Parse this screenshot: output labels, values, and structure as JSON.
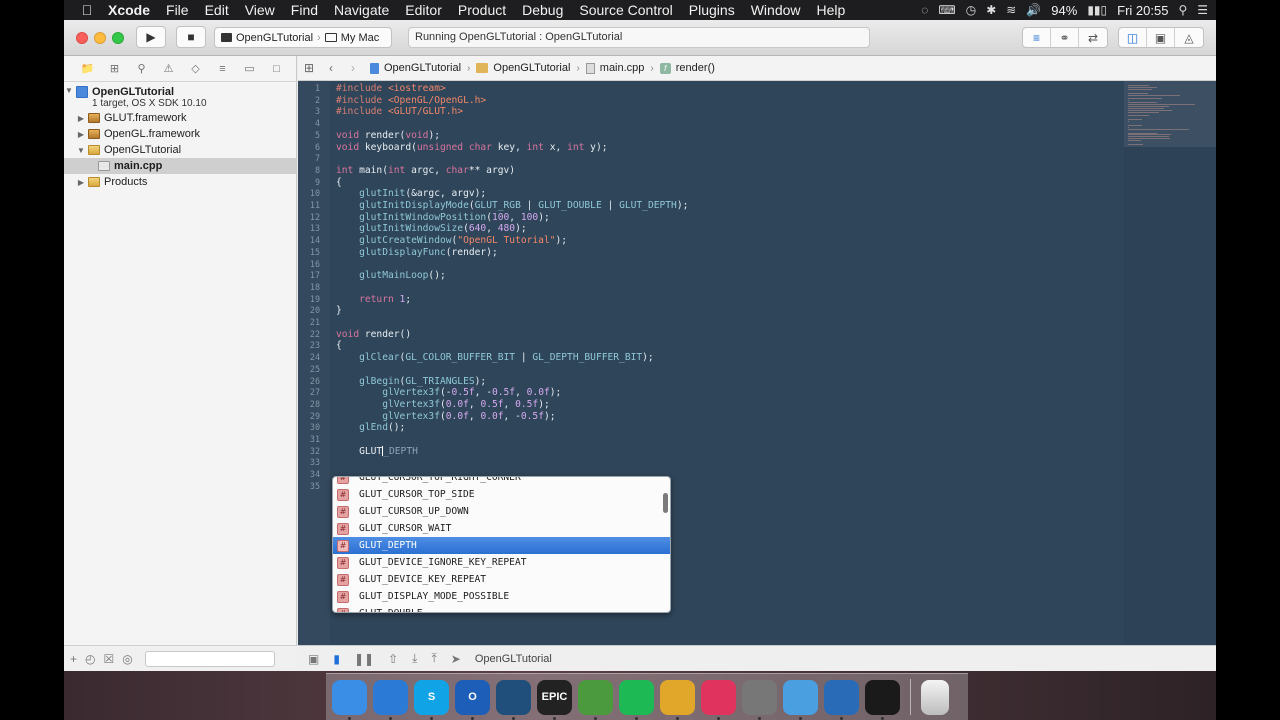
{
  "menubar": {
    "app": "Xcode",
    "items": [
      "File",
      "Edit",
      "View",
      "Find",
      "Navigate",
      "Editor",
      "Product",
      "Debug",
      "Source Control",
      "Plugins",
      "Window",
      "Help"
    ],
    "battery": "94%",
    "clock": "Fri 20:55"
  },
  "toolbar": {
    "scheme": "OpenGLTutorial",
    "destination": "My Mac",
    "activity": "Running OpenGLTutorial : OpenGLTutorial"
  },
  "navigator": {
    "project": {
      "name": "OpenGLTutorial",
      "subtitle": "1 target, OS X SDK 10.10"
    },
    "items": [
      {
        "label": "GLUT.framework"
      },
      {
        "label": "OpenGL.framework"
      },
      {
        "label": "OpenGLTutorial"
      },
      {
        "label": "main.cpp"
      },
      {
        "label": "Products"
      }
    ]
  },
  "jumpbar": {
    "crumbs": [
      "OpenGLTutorial",
      "OpenGLTutorial",
      "main.cpp",
      "render()"
    ]
  },
  "editor": {
    "code": [
      {
        "n": "1",
        "t": [
          [
            "pp",
            "#include "
          ],
          [
            "str",
            "<iostream>"
          ]
        ]
      },
      {
        "n": "2",
        "t": [
          [
            "pp",
            "#include "
          ],
          [
            "str",
            "<OpenGL/OpenGL.h>"
          ]
        ]
      },
      {
        "n": "3",
        "t": [
          [
            "pp",
            "#include "
          ],
          [
            "str",
            "<GLUT/GLUT.h>"
          ]
        ]
      },
      {
        "n": "4",
        "t": []
      },
      {
        "n": "5",
        "t": [
          [
            "kw",
            "void"
          ],
          [
            "pl",
            " render("
          ],
          [
            "kw",
            "void"
          ],
          [
            "pl",
            ");"
          ]
        ]
      },
      {
        "n": "6",
        "t": [
          [
            "kw",
            "void"
          ],
          [
            "pl",
            " keyboard("
          ],
          [
            "kw",
            "unsigned char"
          ],
          [
            "pl",
            " key, "
          ],
          [
            "kw",
            "int"
          ],
          [
            "pl",
            " x, "
          ],
          [
            "kw",
            "int"
          ],
          [
            "pl",
            " y);"
          ]
        ]
      },
      {
        "n": "7",
        "t": []
      },
      {
        "n": "8",
        "t": [
          [
            "kw",
            "int"
          ],
          [
            "pl",
            " main("
          ],
          [
            "kw",
            "int"
          ],
          [
            "pl",
            " argc, "
          ],
          [
            "kw",
            "char"
          ],
          [
            "pl",
            "** argv)"
          ]
        ]
      },
      {
        "n": "9",
        "t": [
          [
            "pl",
            "{"
          ]
        ]
      },
      {
        "n": "10",
        "t": [
          [
            "pl",
            "    "
          ],
          [
            "fn",
            "glutInit"
          ],
          [
            "pl",
            "(&argc, argv);"
          ]
        ]
      },
      {
        "n": "11",
        "t": [
          [
            "pl",
            "    "
          ],
          [
            "fn",
            "glutInitDisplayMode"
          ],
          [
            "pl",
            "("
          ],
          [
            "fn",
            "GLUT_RGB"
          ],
          [
            "pl",
            " | "
          ],
          [
            "fn",
            "GLUT_DOUBLE"
          ],
          [
            "pl",
            " | "
          ],
          [
            "fn",
            "GLUT_DEPTH"
          ],
          [
            "pl",
            ");"
          ]
        ]
      },
      {
        "n": "12",
        "t": [
          [
            "pl",
            "    "
          ],
          [
            "fn",
            "glutInitWindowPosition"
          ],
          [
            "pl",
            "("
          ],
          [
            "num",
            "100"
          ],
          [
            "pl",
            ", "
          ],
          [
            "num",
            "100"
          ],
          [
            "pl",
            ");"
          ]
        ]
      },
      {
        "n": "13",
        "t": [
          [
            "pl",
            "    "
          ],
          [
            "fn",
            "glutInitWindowSize"
          ],
          [
            "pl",
            "("
          ],
          [
            "num",
            "640"
          ],
          [
            "pl",
            ", "
          ],
          [
            "num",
            "480"
          ],
          [
            "pl",
            ");"
          ]
        ]
      },
      {
        "n": "14",
        "t": [
          [
            "pl",
            "    "
          ],
          [
            "fn",
            "glutCreateWindow"
          ],
          [
            "pl",
            "("
          ],
          [
            "str",
            "\"OpenGL Tutorial\""
          ],
          [
            "pl",
            ");"
          ]
        ]
      },
      {
        "n": "15",
        "t": [
          [
            "pl",
            "    "
          ],
          [
            "fn",
            "glutDisplayFunc"
          ],
          [
            "pl",
            "(render);"
          ]
        ]
      },
      {
        "n": "16",
        "t": []
      },
      {
        "n": "17",
        "t": [
          [
            "pl",
            "    "
          ],
          [
            "fn",
            "glutMainLoop"
          ],
          [
            "pl",
            "();"
          ]
        ]
      },
      {
        "n": "18",
        "t": []
      },
      {
        "n": "19",
        "t": [
          [
            "pl",
            "    "
          ],
          [
            "kw",
            "return"
          ],
          [
            "pl",
            " "
          ],
          [
            "num",
            "1"
          ],
          [
            "pl",
            ";"
          ]
        ]
      },
      {
        "n": "20",
        "t": [
          [
            "pl",
            "}"
          ]
        ]
      },
      {
        "n": "21",
        "t": []
      },
      {
        "n": "22",
        "t": [
          [
            "kw",
            "void"
          ],
          [
            "pl",
            " render()"
          ]
        ]
      },
      {
        "n": "23",
        "t": [
          [
            "pl",
            "{"
          ]
        ]
      },
      {
        "n": "24",
        "t": [
          [
            "pl",
            "    "
          ],
          [
            "fn",
            "glClear"
          ],
          [
            "pl",
            "("
          ],
          [
            "fn",
            "GL_COLOR_BUFFER_BIT"
          ],
          [
            "pl",
            " | "
          ],
          [
            "fn",
            "GL_DEPTH_BUFFER_BIT"
          ],
          [
            "pl",
            ");"
          ]
        ]
      },
      {
        "n": "25",
        "t": []
      },
      {
        "n": "26",
        "t": [
          [
            "pl",
            "    "
          ],
          [
            "fn",
            "glBegin"
          ],
          [
            "pl",
            "("
          ],
          [
            "fn",
            "GL_TRIANGLES"
          ],
          [
            "pl",
            ");"
          ]
        ]
      },
      {
        "n": "27",
        "t": [
          [
            "pl",
            "        "
          ],
          [
            "fn",
            "glVertex3f"
          ],
          [
            "pl",
            "(-"
          ],
          [
            "num",
            "0.5f"
          ],
          [
            "pl",
            ", -"
          ],
          [
            "num",
            "0.5f"
          ],
          [
            "pl",
            ", "
          ],
          [
            "num",
            "0.0f"
          ],
          [
            "pl",
            ");"
          ]
        ]
      },
      {
        "n": "28",
        "t": [
          [
            "pl",
            "        "
          ],
          [
            "fn",
            "glVertex3f"
          ],
          [
            "pl",
            "("
          ],
          [
            "num",
            "0.0f"
          ],
          [
            "pl",
            ", "
          ],
          [
            "num",
            "0.5f"
          ],
          [
            "pl",
            ", "
          ],
          [
            "num",
            "0.5f"
          ],
          [
            "pl",
            ");"
          ]
        ]
      },
      {
        "n": "29",
        "t": [
          [
            "pl",
            "        "
          ],
          [
            "fn",
            "glVertex3f"
          ],
          [
            "pl",
            "("
          ],
          [
            "num",
            "0.0f"
          ],
          [
            "pl",
            ", "
          ],
          [
            "num",
            "0.0f"
          ],
          [
            "pl",
            ", -"
          ],
          [
            "num",
            "0.5f"
          ],
          [
            "pl",
            ");"
          ]
        ]
      },
      {
        "n": "30",
        "t": [
          [
            "pl",
            "    "
          ],
          [
            "fn",
            "glEnd"
          ],
          [
            "pl",
            "();"
          ]
        ]
      },
      {
        "n": "31",
        "t": []
      },
      {
        "n": "32",
        "t": [
          [
            "pl",
            "    GLUT"
          ],
          [
            "cursor",
            ""
          ],
          [
            "ghost",
            "_DEPTH"
          ]
        ]
      },
      {
        "n": "33",
        "t": []
      },
      {
        "n": "34",
        "t": []
      },
      {
        "n": "35",
        "t": []
      }
    ]
  },
  "completion": {
    "items": [
      "GLUT_CURSOR_TOP_RIGHT_CORNER",
      "GLUT_CURSOR_TOP_SIDE",
      "GLUT_CURSOR_UP_DOWN",
      "GLUT_CURSOR_WAIT",
      "GLUT_DEPTH",
      "GLUT_DEVICE_IGNORE_KEY_REPEAT",
      "GLUT_DEVICE_KEY_REPEAT",
      "GLUT_DISPLAY_MODE_POSSIBLE",
      "GLUT_DOUBLE"
    ],
    "selected": "GLUT_DEPTH",
    "badge": "#"
  },
  "debugbar": {
    "target": "OpenGLTutorial"
  },
  "dock": {
    "apps": [
      {
        "name": "finder-icon",
        "color": "#3a8ee6",
        "label": ""
      },
      {
        "name": "xcode-icon",
        "color": "#2b7bd6",
        "label": ""
      },
      {
        "name": "skype-icon",
        "color": "#10a4e6",
        "label": "S"
      },
      {
        "name": "outlook-icon",
        "color": "#1d5fb8",
        "label": "O"
      },
      {
        "name": "sourcetree-icon",
        "color": "#1f4f7a",
        "label": ""
      },
      {
        "name": "epic-games-icon",
        "color": "#222222",
        "label": "EPIC"
      },
      {
        "name": "evernote-icon",
        "color": "#4c9a3e",
        "label": ""
      },
      {
        "name": "spotify-icon",
        "color": "#1db954",
        "label": ""
      },
      {
        "name": "chrome-icon",
        "color": "#e0a72a",
        "label": ""
      },
      {
        "name": "itunes-icon",
        "color": "#e0335d",
        "label": ""
      },
      {
        "name": "system-preferences-icon",
        "color": "#777777",
        "label": ""
      },
      {
        "name": "migration-icon",
        "color": "#4a9fe0",
        "label": ""
      },
      {
        "name": "edge-icon",
        "color": "#2a6bb8",
        "label": ""
      },
      {
        "name": "terminal-icon",
        "color": "#1a1a1a",
        "label": ""
      }
    ],
    "trash": "trash-icon"
  }
}
